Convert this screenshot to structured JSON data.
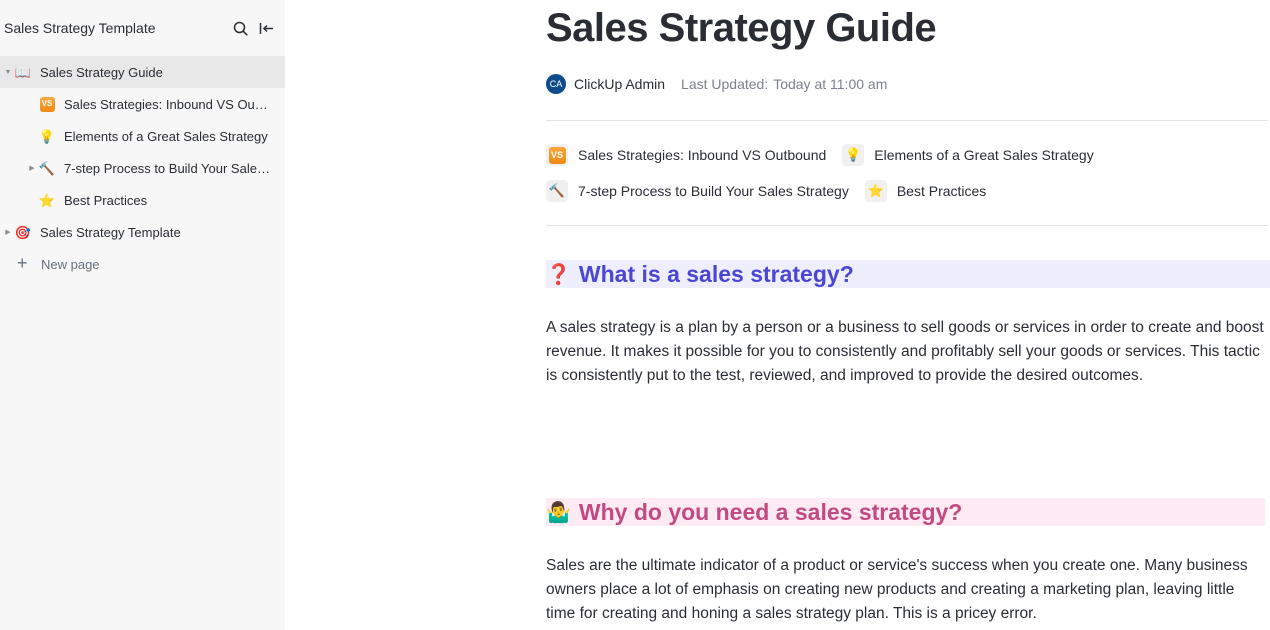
{
  "sidebar": {
    "title": "Sales Strategy Template",
    "icons": {
      "search": "search-icon",
      "collapse": "collapse-sidebar-icon"
    },
    "items": [
      {
        "label": "Sales Strategy Guide",
        "icon": "📖",
        "icon_name": "book-icon",
        "level": 0,
        "caret": "expanded",
        "active": true
      },
      {
        "label": "Sales Strategies: Inbound VS Outbound",
        "icon": "VS",
        "icon_name": "vs-badge-icon",
        "level": 1,
        "caret": "none"
      },
      {
        "label": "Elements of a Great Sales Strategy",
        "icon": "💡",
        "icon_name": "lightbulb-icon",
        "level": 1,
        "caret": "none"
      },
      {
        "label": "7-step Process to Build Your Sales Strategy",
        "icon": "🔨",
        "icon_name": "hammer-icon",
        "level": 1,
        "caret": "collapsed"
      },
      {
        "label": "Best Practices",
        "icon": "⭐",
        "icon_name": "star-icon",
        "level": 1,
        "caret": "none"
      },
      {
        "label": "Sales Strategy Template",
        "icon": "🎯",
        "icon_name": "target-icon",
        "level": 0,
        "caret": "collapsed"
      }
    ],
    "new_page_label": "New page"
  },
  "document": {
    "title": "Sales Strategy Guide",
    "author_initials": "CA",
    "author": "ClickUp Admin",
    "updated_label": "Last Updated:",
    "updated_value": "Today at 11:00 am",
    "subpage_links": [
      {
        "label": "Sales Strategies: Inbound VS Outbound",
        "icon": "VS",
        "icon_name": "vs-badge-icon"
      },
      {
        "label": "Elements of a Great Sales Strategy",
        "icon": "💡",
        "icon_name": "lightbulb-icon"
      },
      {
        "label": "7-step Process to Build Your Sales Strategy",
        "icon": "🔨",
        "icon_name": "hammer-icon"
      },
      {
        "label": "Best Practices",
        "icon": "⭐",
        "icon_name": "star-icon"
      }
    ],
    "sections": [
      {
        "heading": "What is a sales strategy?",
        "icon": "❓",
        "icon_name": "question-mark-icon",
        "color": "#4b46d6",
        "background": "#eeeefc",
        "body": "A sales strategy is a plan by a person or a business to sell goods or services in order to create and boost revenue. It makes it possible for you to consistently and profitably sell your goods or services. This tactic is consistently put to the test, reviewed, and improved to provide the desired outcomes."
      },
      {
        "heading": "Why do you need a sales strategy?",
        "icon": "🤷‍♂️",
        "icon_name": "person-shrugging-icon",
        "color": "#c14a81",
        "background": "#fdeaf3",
        "body": "Sales are the ultimate indicator of a product or service's success when you create one. Many business owners place a lot of emphasis on creating new products and creating a marketing plan, leaving little time for creating and honing a sales strategy plan. This is a pricey error."
      }
    ]
  }
}
